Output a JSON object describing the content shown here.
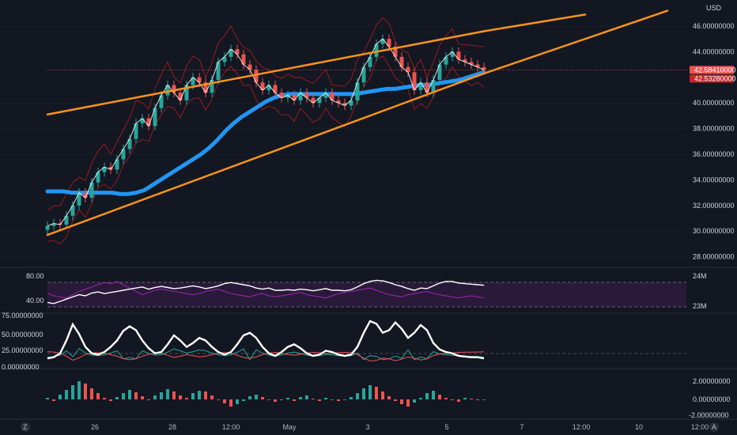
{
  "colors": {
    "background": "#131722",
    "pane_separator": "#2a2e39",
    "grid": "#1e222d",
    "trendline": "#f7931a",
    "ma_long": "#2196f3",
    "candle_up": "#26a69a",
    "candle_down": "#ef5350",
    "bands": "#b71c1c",
    "rsi_band": "#2a1a3a",
    "rsi_line": "#ffffff",
    "rsi_secondary": "#9c27b0",
    "dmi_line": "#ffffff",
    "dmi_plus": "#26a69a",
    "dmi_minus": "#ef5350",
    "macd_up": "#26a69a",
    "macd_down": "#ef5350",
    "badge_red": "#ef5350",
    "badge_dark": "#c62828",
    "current_price_line": "#ef5350"
  },
  "main_pane": {
    "currency": "USD",
    "price_axis": [
      "46.00000000",
      "44.00000000",
      "42.00000000",
      "40.00000000",
      "38.00000000",
      "36.00000000",
      "34.00000000",
      "32.00000000",
      "30.00000000",
      "28.00000000"
    ],
    "badge_upper": "42.58410000",
    "badge_lower": "42.53280000"
  },
  "rsi_pane": {
    "left_ticks": [
      "80.00",
      "40.00"
    ],
    "right_ticks": [
      "24M",
      "23M"
    ]
  },
  "dmi_pane": {
    "left_ticks": [
      "75.00000000",
      "50.00000000",
      "25.00000000",
      "0.00000000"
    ]
  },
  "macd_pane": {
    "right_ticks": [
      "2.00000000",
      "0.00000000",
      "-2.00000000"
    ]
  },
  "time_axis": {
    "labels": [
      "26",
      "28",
      "12:00",
      "May",
      "3",
      "5",
      "7",
      "12:00",
      "10",
      "12:00"
    ],
    "left_icon": "Z",
    "right_icon": "A"
  },
  "icons": {
    "left_corner": "timezone-icon",
    "right_corner": "auto-scale-icon"
  },
  "chart_data": {
    "type": "candlestick",
    "price_range": [
      27.5,
      47
    ],
    "close_series": [
      30.4,
      30.6,
      30.5,
      31.2,
      32.0,
      33.0,
      32.6,
      33.8,
      34.6,
      35.0,
      34.8,
      35.6,
      36.4,
      37.2,
      38.4,
      38.8,
      38.2,
      39.6,
      40.6,
      41.4,
      40.8,
      40.2,
      41.4,
      42.0,
      41.6,
      40.8,
      41.8,
      43.2,
      43.6,
      44.2,
      43.8,
      43.0,
      42.6,
      41.6,
      41.0,
      41.4,
      40.8,
      40.4,
      40.6,
      40.2,
      40.8,
      40.4,
      40.0,
      40.4,
      40.8,
      40.2,
      40.0,
      39.8,
      40.2,
      41.6,
      42.8,
      43.6,
      44.6,
      45.0,
      44.4,
      43.6,
      42.8,
      42.4,
      41.0,
      41.6,
      40.8,
      41.8,
      43.0,
      43.6,
      44.0,
      43.4,
      43.2,
      43.0,
      42.8,
      42.58
    ],
    "ma_long": [
      33.1,
      33.1,
      33.1,
      33.0,
      33.0,
      33.0,
      33.0,
      33.0,
      33.0,
      32.9,
      32.9,
      33.0,
      33.2,
      33.6,
      34.0,
      34.4,
      34.8,
      35.2,
      35.6,
      36.0,
      36.5,
      37.1,
      37.8,
      38.4,
      38.9,
      39.3,
      39.7,
      40.1,
      40.4,
      40.6,
      40.7,
      40.7,
      40.7,
      40.7,
      40.7,
      40.7,
      40.7,
      40.7,
      40.7,
      40.8,
      40.9,
      41.0,
      41.1,
      41.1,
      41.2,
      41.3,
      41.4,
      41.4,
      41.5,
      41.6,
      41.7,
      41.8,
      42.0,
      42.2,
      42.4
    ],
    "trend_upper": {
      "from": [
        0,
        39.1
      ],
      "to": [
        69,
        45.6
      ]
    },
    "trend_lower": {
      "from": [
        0,
        29.7
      ],
      "to": [
        69,
        42.3
      ]
    },
    "trend_lower_extension": {
      "from": [
        69,
        42.3
      ],
      "to": [
        98,
        47.2
      ]
    },
    "trend_upper_extension": {
      "from": [
        69,
        45.6
      ],
      "to": [
        85,
        46.9
      ]
    },
    "rsi": [
      38,
      36,
      40,
      44,
      48,
      52,
      50,
      55,
      57,
      54,
      56,
      58,
      60,
      62,
      64,
      66,
      62,
      65,
      67,
      65,
      63,
      64,
      66,
      68,
      66,
      63,
      65,
      68,
      72,
      74,
      72,
      70,
      68,
      64,
      62,
      64,
      60,
      60,
      61,
      60,
      62,
      61,
      59,
      61,
      63,
      60,
      60,
      59,
      61,
      66,
      72,
      76,
      78,
      77,
      74,
      70,
      67,
      63,
      60,
      64,
      63,
      68,
      73,
      76,
      76,
      73,
      72,
      71,
      70,
      69
    ],
    "rsi_secondary": [
      55,
      50,
      48,
      46,
      52,
      58,
      62,
      66,
      70,
      74,
      72,
      76,
      70,
      64,
      58,
      52,
      56,
      60,
      62,
      60,
      58,
      56,
      54,
      52,
      54,
      58,
      60,
      62,
      58,
      54,
      52,
      50,
      48,
      52,
      54,
      50,
      48,
      50,
      52,
      54,
      56,
      52,
      50,
      48,
      46,
      50,
      54,
      56,
      58,
      60,
      62,
      64,
      60,
      56,
      52,
      50,
      48,
      52,
      54,
      56,
      58,
      54,
      52,
      50,
      48,
      46,
      48,
      50,
      48,
      46
    ],
    "dmi_adx": [
      12,
      14,
      20,
      40,
      65,
      50,
      30,
      20,
      18,
      22,
      30,
      40,
      55,
      62,
      56,
      40,
      28,
      20,
      22,
      34,
      48,
      40,
      30,
      36,
      44,
      40,
      30,
      22,
      18,
      22,
      34,
      48,
      52,
      44,
      30,
      20,
      16,
      22,
      30,
      34,
      28,
      20,
      16,
      18,
      24,
      22,
      18,
      16,
      18,
      30,
      52,
      70,
      66,
      52,
      56,
      68,
      58,
      44,
      52,
      64,
      56,
      36,
      26,
      22,
      20,
      16,
      15,
      14,
      14,
      12
    ],
    "macd": [
      0.2,
      -0.2,
      0.6,
      1.2,
      1.8,
      2.3,
      2.0,
      1.4,
      0.8,
      0.2,
      -0.2,
      0.3,
      0.8,
      1.2,
      0.9,
      0.4,
      -0.1,
      0.5,
      0.9,
      1.3,
      1.0,
      0.5,
      0.2,
      0.8,
      1.1,
      1.0,
      0.5,
      0.0,
      -0.5,
      -0.9,
      -0.6,
      -0.2,
      0.4,
      0.6,
      0.3,
      0.0,
      -0.3,
      -0.1,
      0.2,
      -0.2,
      0.3,
      0.5,
      0.1,
      -0.2,
      0.2,
      0.0,
      -0.2,
      0.0,
      0.3,
      0.8,
      1.4,
      1.8,
      1.6,
      1.0,
      0.4,
      -0.2,
      -0.6,
      -0.9,
      -0.4,
      0.2,
      0.8,
      1.1,
      0.6,
      0.2,
      -0.1,
      -0.3,
      0.2,
      0.1,
      -0.1,
      0.0
    ]
  }
}
